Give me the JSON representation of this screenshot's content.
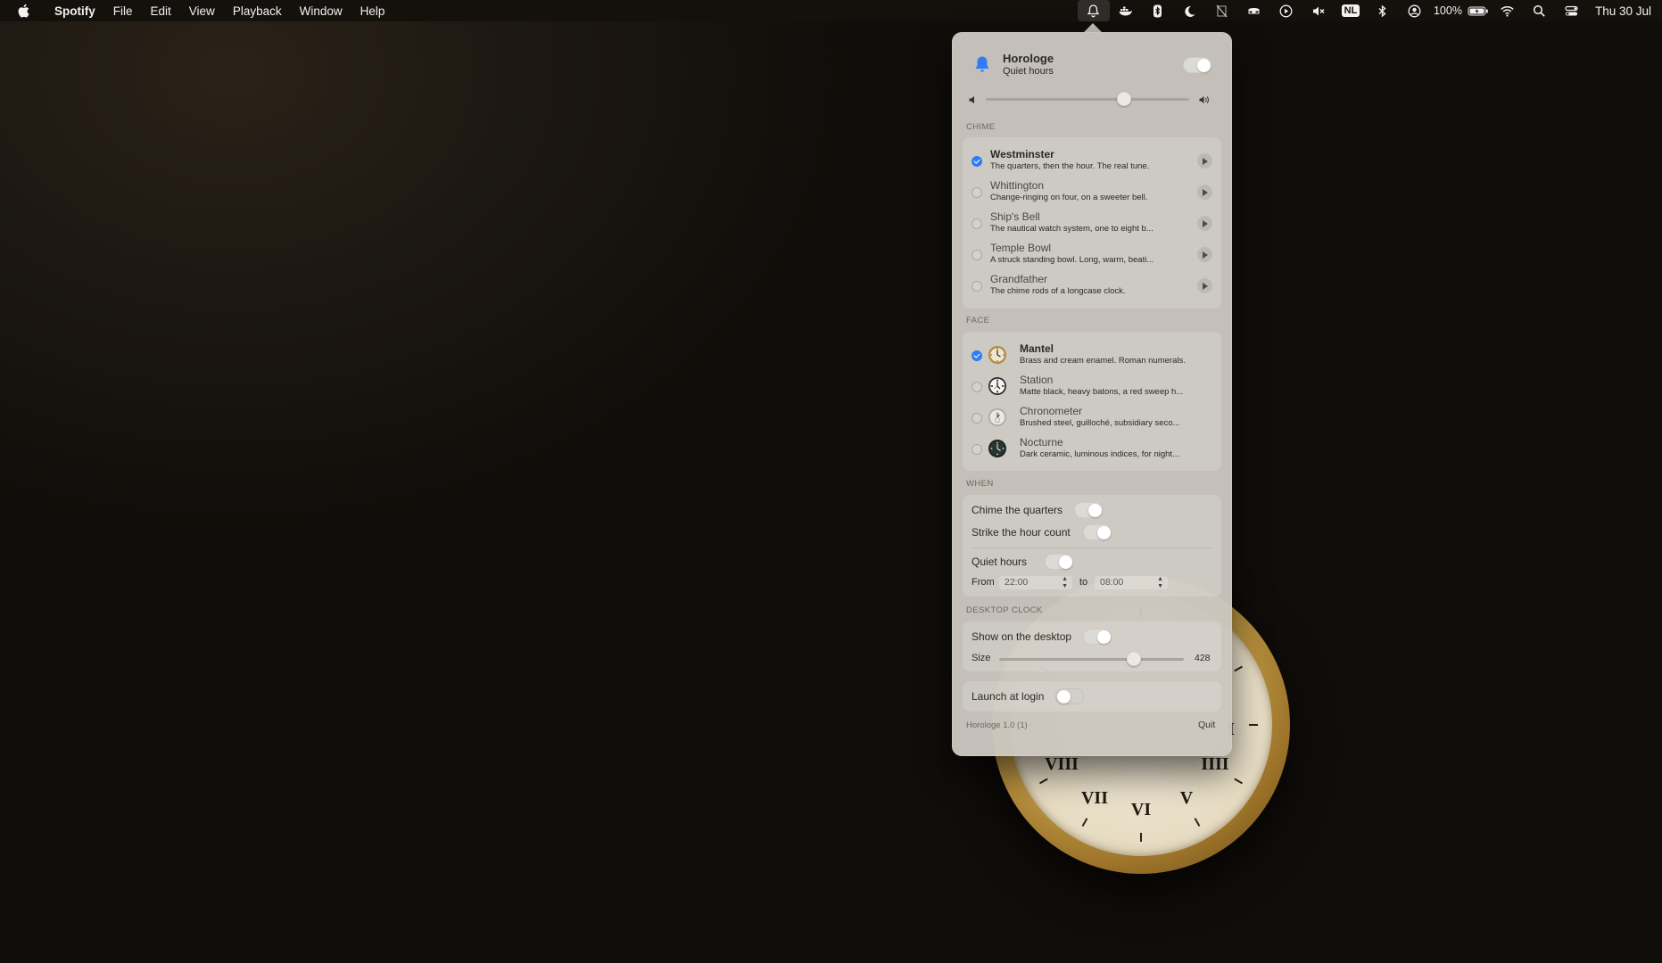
{
  "menubar": {
    "app_name": "Spotify",
    "menus": [
      "File",
      "Edit",
      "View",
      "Playback",
      "Window",
      "Help"
    ],
    "battery": "100%",
    "keyboard_layout": "NL",
    "datetime": "Thu 30 Jul",
    "status_icons": [
      "bell-icon",
      "docker-icon",
      "bluetooth-tool-icon",
      "moon-icon",
      "crossed-app-icon",
      "dock-icon",
      "play-circle-icon",
      "mute-icon",
      "keyboard-layout-icon",
      "bluetooth-icon",
      "user-icon",
      "battery-icon",
      "wifi-icon",
      "search-icon",
      "control-center-icon"
    ]
  },
  "popover": {
    "app_title": "Horologe",
    "app_subtitle": "Quiet hours",
    "master_toggle": true,
    "volume_level": 0.68,
    "chime": {
      "section_label": "CHIME",
      "items": [
        {
          "name": "Westminster",
          "description": "The quarters, then the hour. The real tune.",
          "selected": true
        },
        {
          "name": "Whittington",
          "description": "Change-ringing on four, on a sweeter bell.",
          "selected": false
        },
        {
          "name": "Ship's Bell",
          "description": "The nautical watch system, one to eight b...",
          "selected": false
        },
        {
          "name": "Temple Bowl",
          "description": "A struck standing bowl. Long, warm, beati...",
          "selected": false
        },
        {
          "name": "Grandfather",
          "description": "The chime rods of a longcase clock.",
          "selected": false
        }
      ]
    },
    "face": {
      "section_label": "FACE",
      "items": [
        {
          "name": "Mantel",
          "description": "Brass and cream enamel. Roman numerals.",
          "selected": true,
          "icon": "mantel-face-icon"
        },
        {
          "name": "Station",
          "description": "Matte black, heavy batons, a red sweep h...",
          "selected": false,
          "icon": "station-face-icon"
        },
        {
          "name": "Chronometer",
          "description": "Brushed steel, guilloché, subsidiary seco...",
          "selected": false,
          "icon": "chronometer-face-icon"
        },
        {
          "name": "Nocturne",
          "description": "Dark ceramic, luminous indices, for night...",
          "selected": false,
          "icon": "nocturne-face-icon"
        }
      ]
    },
    "when": {
      "section_label": "WHEN",
      "chime_quarters_label": "Chime the quarters",
      "chime_quarters": true,
      "strike_hour_label": "Strike the hour count",
      "strike_hour": true,
      "quiet_hours_label": "Quiet hours",
      "quiet_hours": true,
      "from_label": "From",
      "from_value": "22:00",
      "to_label": "to",
      "to_value": "08:00"
    },
    "desktop_clock": {
      "section_label": "DESKTOP CLOCK",
      "show_label": "Show on the desktop",
      "show": true,
      "size_label": "Size",
      "size_value": "428",
      "size_fraction": 0.73
    },
    "launch_at_login_label": "Launch at login",
    "launch_at_login": false,
    "version": "Horologe 1.0 (1)",
    "quit_label": "Quit"
  },
  "desktop_clock_numerals": [
    "VIII",
    "VII",
    "VI",
    "V",
    "IIII",
    "I"
  ],
  "colors": {
    "accent": "#2f7cf6",
    "popover_bg": "#cac5be",
    "menubar_bg": "#14110d"
  }
}
